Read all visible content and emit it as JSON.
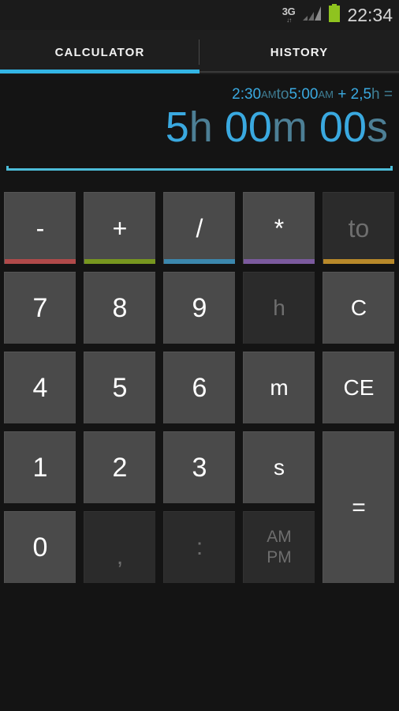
{
  "status_bar": {
    "network_label": "3G",
    "network_arrows": "↓↑",
    "clock": "22:34",
    "battery_color": "#8fc31f",
    "signal_icon": "signal-bars-icon",
    "battery_icon": "battery-full-icon"
  },
  "tabs": {
    "items": [
      {
        "label": "CALCULATOR",
        "active": true
      },
      {
        "label": "HISTORY",
        "active": false
      }
    ],
    "indicator_color": "#33b5e5"
  },
  "display": {
    "expression": {
      "full_text": "2:30AMto5:00AM + 2,5h =",
      "parts": [
        {
          "text": "2:30",
          "style": "num"
        },
        {
          "text": "AM",
          "style": "small"
        },
        {
          "text": "to",
          "style": "unit"
        },
        {
          "text": "5:00",
          "style": "num"
        },
        {
          "text": "AM",
          "style": "small"
        },
        {
          "text": " + ",
          "style": "op"
        },
        {
          "text": "2,5",
          "style": "num"
        },
        {
          "text": "h",
          "style": "unit"
        },
        {
          "text": " =",
          "style": "unit"
        }
      ],
      "t1": "2:30",
      "t1_ampm": "AM",
      "to": "to",
      "t2": "5:00",
      "t2_ampm": "AM",
      "plus": " + ",
      "addend": "2,5",
      "addend_unit": "h",
      "equals": " ="
    },
    "result": {
      "full_text": "5h 00m 00s",
      "hours": "5",
      "hours_unit": "h",
      "minutes": "00",
      "minutes_unit": "m",
      "seconds": "00",
      "seconds_unit": "s",
      "space1": " ",
      "space2": " "
    },
    "number_color": "#3aa9e0",
    "unit_color": "#4d7f95",
    "rule_color": "#4cbcd8"
  },
  "keypad": {
    "keys": [
      {
        "name": "minus",
        "label": "-",
        "accent": "#b14a4a",
        "disabled": false,
        "kind": "op"
      },
      {
        "name": "plus",
        "label": "+",
        "accent": "#77971f",
        "disabled": false,
        "kind": "op"
      },
      {
        "name": "divide",
        "label": "/",
        "accent": "#3b87ad",
        "disabled": false,
        "kind": "op"
      },
      {
        "name": "multiply",
        "label": "*",
        "accent": "#7b5a9e",
        "disabled": false,
        "kind": "op"
      },
      {
        "name": "to",
        "label": "to",
        "accent": "#b8892a",
        "disabled": true,
        "kind": "op"
      },
      {
        "name": "seven",
        "label": "7",
        "accent": null,
        "disabled": false,
        "kind": "digit"
      },
      {
        "name": "eight",
        "label": "8",
        "accent": null,
        "disabled": false,
        "kind": "digit"
      },
      {
        "name": "nine",
        "label": "9",
        "accent": null,
        "disabled": false,
        "kind": "digit"
      },
      {
        "name": "hours",
        "label": "h",
        "accent": null,
        "disabled": true,
        "kind": "unit"
      },
      {
        "name": "clear",
        "label": "C",
        "accent": null,
        "disabled": false,
        "kind": "action"
      },
      {
        "name": "four",
        "label": "4",
        "accent": null,
        "disabled": false,
        "kind": "digit"
      },
      {
        "name": "five",
        "label": "5",
        "accent": null,
        "disabled": false,
        "kind": "digit"
      },
      {
        "name": "six",
        "label": "6",
        "accent": null,
        "disabled": false,
        "kind": "digit"
      },
      {
        "name": "minutes",
        "label": "m",
        "accent": null,
        "disabled": false,
        "kind": "unit"
      },
      {
        "name": "clear-entry",
        "label": "CE",
        "accent": null,
        "disabled": false,
        "kind": "action"
      },
      {
        "name": "one",
        "label": "1",
        "accent": null,
        "disabled": false,
        "kind": "digit"
      },
      {
        "name": "two",
        "label": "2",
        "accent": null,
        "disabled": false,
        "kind": "digit"
      },
      {
        "name": "three",
        "label": "3",
        "accent": null,
        "disabled": false,
        "kind": "digit"
      },
      {
        "name": "seconds",
        "label": "s",
        "accent": null,
        "disabled": false,
        "kind": "unit"
      },
      {
        "name": "equals",
        "label": "=",
        "accent": null,
        "disabled": false,
        "kind": "action"
      },
      {
        "name": "zero",
        "label": "0",
        "accent": null,
        "disabled": false,
        "kind": "digit"
      },
      {
        "name": "comma",
        "label": ",",
        "accent": null,
        "disabled": true,
        "kind": "sep"
      },
      {
        "name": "colon",
        "label": ":",
        "accent": null,
        "disabled": true,
        "kind": "sep"
      },
      {
        "name": "ampm",
        "label": "AM\nPM",
        "accent": null,
        "disabled": true,
        "kind": "stacked"
      }
    ],
    "ampm_line1": "AM",
    "ampm_line2": "PM",
    "enabled_color": "#4a4a4a",
    "disabled_color": "#2b2b2b"
  }
}
